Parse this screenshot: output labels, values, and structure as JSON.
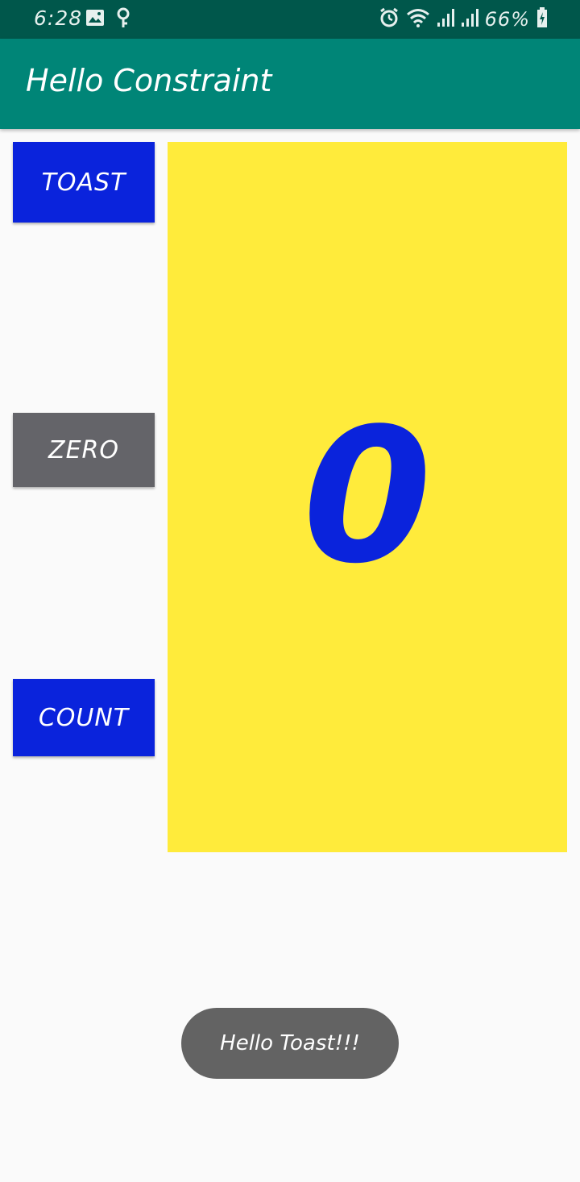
{
  "status_bar": {
    "time": "6:28",
    "battery": "66%",
    "icons": [
      "image-icon",
      "location-icon",
      "alarm-icon",
      "wifi-icon",
      "signal-icon",
      "signal-icon",
      "battery-icon"
    ]
  },
  "app_bar": {
    "title": "Hello Constraint"
  },
  "buttons": {
    "toast_label": "TOAST",
    "zero_label": "ZERO",
    "count_label": "COUNT"
  },
  "counter": {
    "value": "0"
  },
  "toast": {
    "message": "Hello Toast!!!"
  },
  "colors": {
    "status_bar": "#00574b",
    "app_bar": "#008577",
    "button_blue": "#0a23dc",
    "button_gray": "#646469",
    "panel_yellow": "#ffeb3b",
    "count_text": "#0a23dc",
    "toast_bg": "#636363"
  }
}
